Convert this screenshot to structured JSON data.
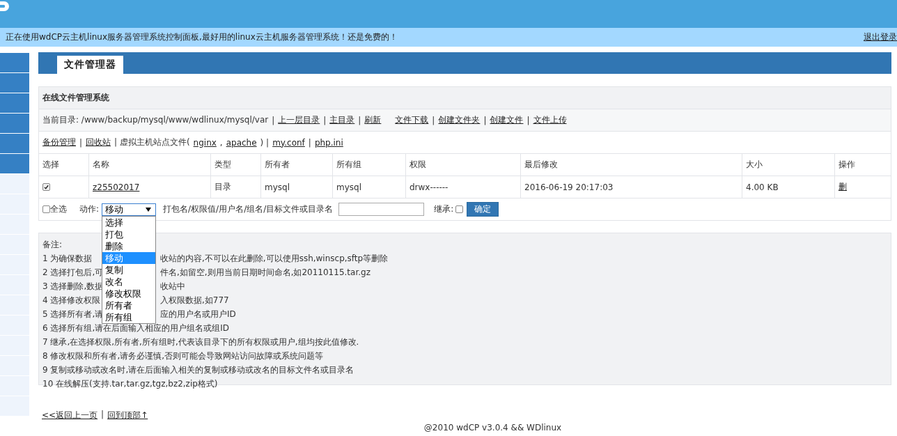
{
  "header": {
    "notice": "正在使用wdCP云主机linux服务器管理系统控制面板,最好用的linux云主机服务器管理系统！还是免费的！",
    "logout": "退出登录"
  },
  "sidebar": {
    "items": [
      {
        "kind": "dark"
      },
      {
        "kind": "dark"
      },
      {
        "kind": "dark"
      },
      {
        "kind": "dark"
      },
      {
        "kind": "dark"
      },
      {
        "kind": "dark"
      },
      {
        "kind": "light"
      },
      {
        "kind": "light"
      },
      {
        "kind": "light"
      },
      {
        "kind": "light"
      },
      {
        "kind": "light"
      },
      {
        "kind": "light"
      },
      {
        "kind": "light"
      },
      {
        "kind": "light"
      },
      {
        "kind": "light"
      },
      {
        "kind": "light"
      },
      {
        "kind": "light"
      },
      {
        "kind": "light"
      }
    ]
  },
  "tabs": [
    {
      "label": "文件管理器",
      "selected": true
    }
  ],
  "panel": {
    "title": "在线文件管理系统",
    "path_label": "当前目录: /www/backup/mysql/www/wdlinux/mysql/var",
    "path_links": [
      {
        "kind": "sep",
        "text": "|"
      },
      {
        "kind": "link",
        "text": "上一层目录"
      },
      {
        "kind": "sep",
        "text": "|"
      },
      {
        "kind": "link",
        "text": "主目录"
      },
      {
        "kind": "sep",
        "text": "|"
      },
      {
        "kind": "link",
        "text": "刷新"
      },
      {
        "kind": "space"
      },
      {
        "kind": "link",
        "text": "文件下载"
      },
      {
        "kind": "sep",
        "text": "|"
      },
      {
        "kind": "link",
        "text": "创建文件夹"
      },
      {
        "kind": "sep",
        "text": "|"
      },
      {
        "kind": "link",
        "text": "创建文件"
      },
      {
        "kind": "sep",
        "text": "|"
      },
      {
        "kind": "link",
        "text": "文件上传"
      }
    ],
    "links": [
      {
        "kind": "link",
        "text": "备份管理"
      },
      {
        "kind": "sep",
        "text": "|"
      },
      {
        "kind": "link",
        "text": "回收站"
      },
      {
        "kind": "sep",
        "text": "| 虚拟主机站点文件("
      },
      {
        "kind": "link",
        "text": "nginx"
      },
      {
        "kind": "sep",
        "text": ","
      },
      {
        "kind": "link",
        "text": "apache"
      },
      {
        "kind": "sep",
        "text": ") |"
      },
      {
        "kind": "link",
        "text": "my.conf"
      },
      {
        "kind": "sep",
        "text": "|"
      },
      {
        "kind": "link",
        "text": "php.ini"
      }
    ]
  },
  "table": {
    "columns": [
      "选择",
      "名称",
      "类型",
      "所有者",
      "所有组",
      "权限",
      "最后修改",
      "大小",
      "操作"
    ],
    "rows": [
      {
        "checked": true,
        "name": "z25502017",
        "type": "目录",
        "owner": "mysql",
        "group": "mysql",
        "perms": "drwx------",
        "modified": "2016-06-19 20:17:03",
        "size": "4.00 KB",
        "action": "删"
      }
    ]
  },
  "actions": {
    "select_all": {
      "label": "全选",
      "checked": false
    },
    "action_label": "动作:",
    "value": "移动",
    "options": [
      {
        "label": "选择",
        "selected": false
      },
      {
        "label": "打包",
        "selected": false
      },
      {
        "label": "删除",
        "selected": false
      },
      {
        "label": "移动",
        "selected": true
      },
      {
        "label": "复制",
        "selected": false
      },
      {
        "label": "改名",
        "selected": false
      },
      {
        "label": "修改权限",
        "selected": false
      },
      {
        "label": "所有者",
        "selected": false
      },
      {
        "label": "所有组",
        "selected": false
      }
    ],
    "target_label": "打包名/权限值/用户名/组名/目标文件或目录名",
    "inherit": {
      "label": "继承:",
      "checked": false
    },
    "submit": "确定"
  },
  "notes": {
    "title": "备注:",
    "lines": [
      {
        "left": "1 为确保数据",
        "right": "收站的内容,不可以在此删除,可以使用ssh,winscp,sftp等删除"
      },
      {
        "left": "2 选择打包后,可",
        "right": "件名,如留空,则用当前日期时间命名,如20110115.tar.gz"
      },
      {
        "left": "3 选择删除,数据",
        "right": "收站中"
      },
      {
        "left": "4 选择修改权限",
        "right": "入权限数据,如777"
      },
      {
        "left": "5 选择所有者,请",
        "right": "应的用户名或用户ID"
      },
      {
        "text": "6 选择所有组,请在后面输入相应的用户组名或组ID"
      },
      {
        "text": "7 继承,在选择权限,所有者,所有组时,代表该目录下的所有权限或用户,组均按此值修改."
      },
      {
        "text": "8 修改权限和所有者,请务必谨慎,否则可能会导致网站访问故障或系统问题等"
      },
      {
        "text": "9 复制或移动或改名时,请在后面输入相关的复制或移动或改名的目标文件名或目录名"
      },
      {
        "text": "10 在线解压(支持.tar,tar.gz,tgz,bz2,zip格式)"
      }
    ]
  },
  "footer": {
    "back": "<<返回上一页",
    "sep": "|",
    "top": "回到顶部↑",
    "copyright": "@2010 wdCP v3.0.4 && WDlinux"
  }
}
